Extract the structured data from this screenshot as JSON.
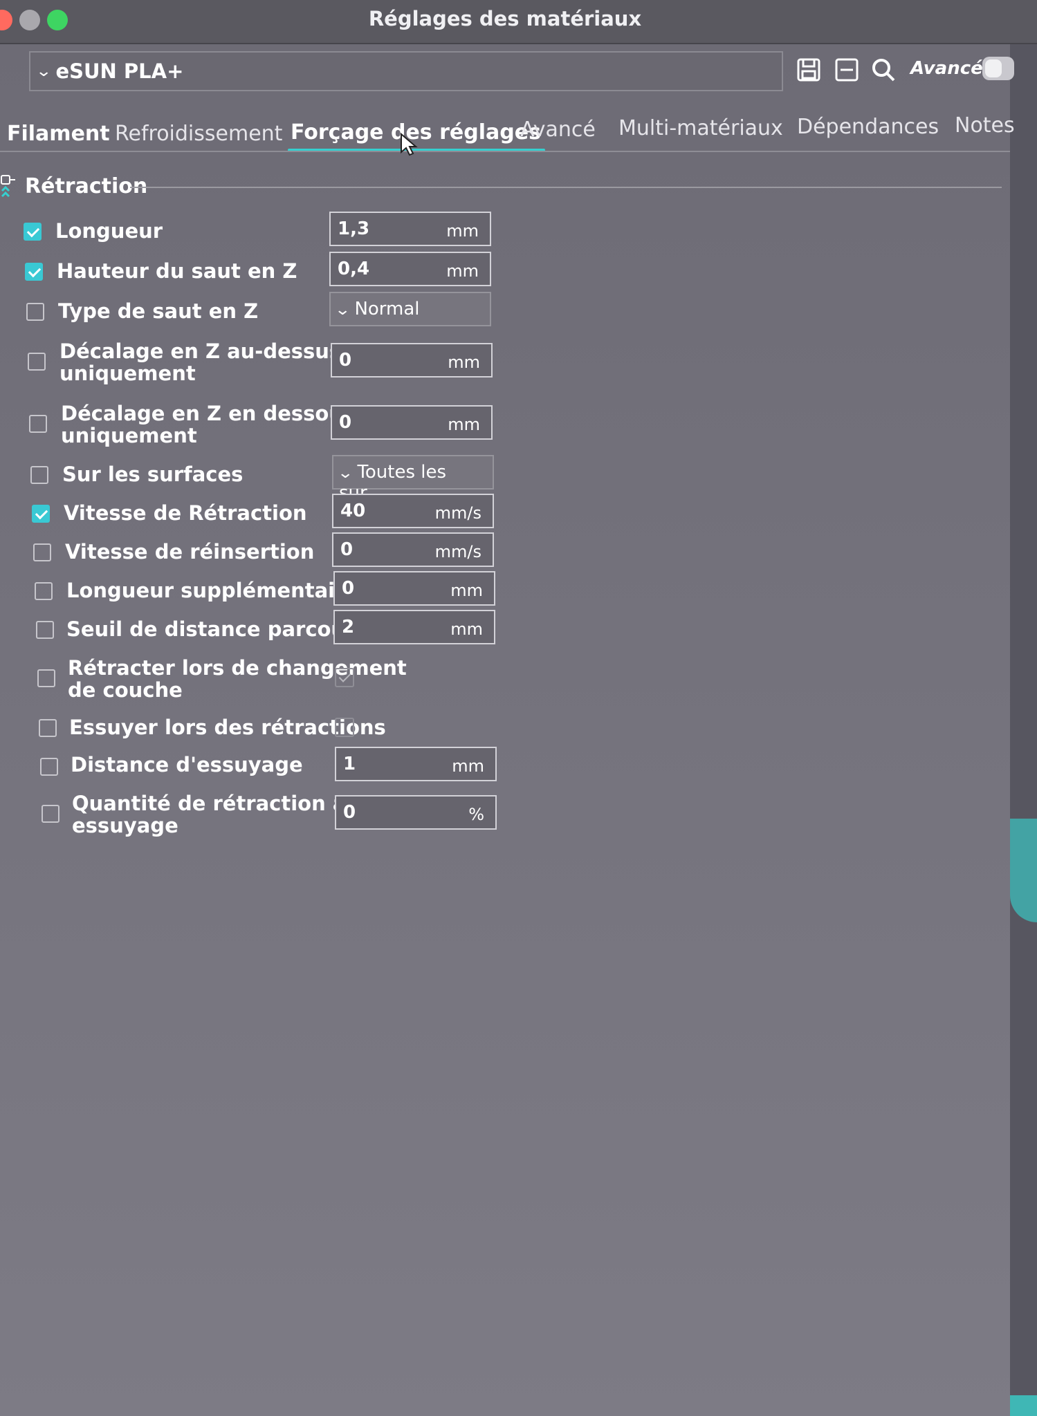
{
  "window": {
    "title": "Réglages des matériaux"
  },
  "preset": {
    "selected": "eSUN PLA+"
  },
  "toolbar": {
    "advanced_label": "Avancé"
  },
  "tabs": [
    {
      "label": "Filament"
    },
    {
      "label": "Refroidissement"
    },
    {
      "label": "Forçage des réglages"
    },
    {
      "label": "Avancé"
    },
    {
      "label": "Multi-matériaux"
    },
    {
      "label": "Dépendances"
    },
    {
      "label": "Notes"
    }
  ],
  "section": {
    "title": "Rétraction"
  },
  "rows": [
    {
      "label": "Longueur",
      "checked": true,
      "value": "1,3",
      "unit": "mm"
    },
    {
      "label": "Hauteur du saut en Z",
      "checked": true,
      "value": "0,4",
      "unit": "mm"
    },
    {
      "label": "Type de saut en Z",
      "checked": false,
      "value": "Normal"
    },
    {
      "label_line1": "Décalage en Z au-dessus",
      "label_line2": "uniquement",
      "checked": false,
      "value": "0",
      "unit": "mm"
    },
    {
      "label_line1": "Décalage en Z en dessous",
      "label_line2": "uniquement",
      "checked": false,
      "value": "0",
      "unit": "mm"
    },
    {
      "label": "Sur les surfaces",
      "checked": false,
      "value": "Toutes les sur..."
    },
    {
      "label": "Vitesse de Rétraction",
      "checked": true,
      "value": "40",
      "unit": "mm/s"
    },
    {
      "label": "Vitesse de réinsertion",
      "checked": false,
      "value": "0",
      "unit": "mm/s"
    },
    {
      "label": "Longueur supplémentaire",
      "checked": false,
      "value": "0",
      "unit": "mm"
    },
    {
      "label": "Seuil de distance parcourue",
      "checked": false,
      "value": "2",
      "unit": "mm"
    },
    {
      "label_line1": "Rétracter lors de changement",
      "label_line2": "de couche",
      "checked": false,
      "value_checked": true
    },
    {
      "label": "Essuyer lors des rétractions",
      "checked": false,
      "value_checked": false
    },
    {
      "label": "Distance d'essuyage",
      "checked": false,
      "value": "1",
      "unit": "mm"
    },
    {
      "label_line1": "Quantité de rétraction avant",
      "label_line2": "essuyage",
      "checked": false,
      "value": "0",
      "unit": "%"
    }
  ],
  "colors": {
    "accent": "#39c9d4",
    "background": "#6c6a72",
    "titlebar": "#5a5960"
  }
}
